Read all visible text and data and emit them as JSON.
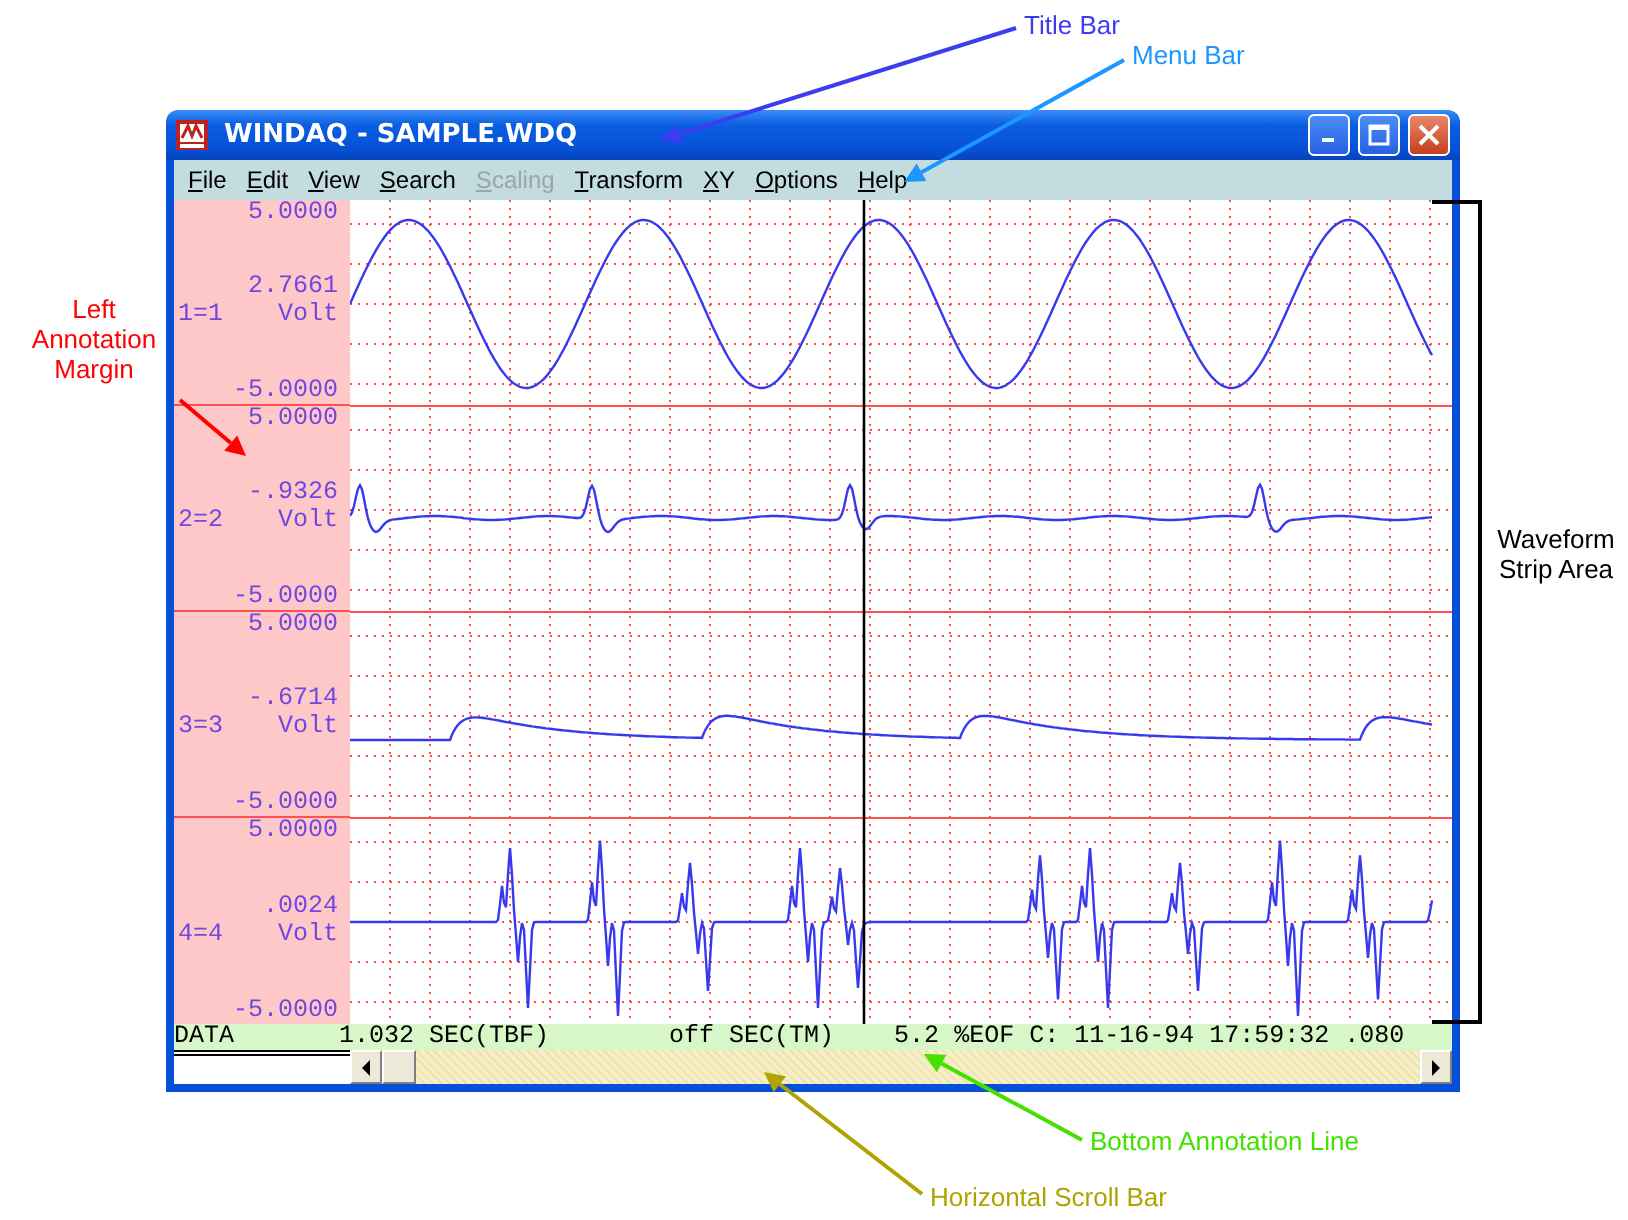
{
  "window": {
    "title": "WINDAQ - SAMPLE.WDQ"
  },
  "menu": [
    {
      "label": "File",
      "disabled": false
    },
    {
      "label": "Edit",
      "disabled": false
    },
    {
      "label": "View",
      "disabled": false
    },
    {
      "label": "Search",
      "disabled": false
    },
    {
      "label": "Scaling",
      "disabled": true
    },
    {
      "label": "Transform",
      "disabled": false
    },
    {
      "label": "XY",
      "disabled": false
    },
    {
      "label": "Options",
      "disabled": false
    },
    {
      "label": "Help",
      "disabled": false
    }
  ],
  "strips": [
    {
      "top_scale": "5.0000",
      "value": "2.7661",
      "channel": "1=1",
      "unit": "Volt",
      "bottom_scale": "-5.0000"
    },
    {
      "top_scale": "5.0000",
      "value": "-.9326",
      "channel": "2=2",
      "unit": "Volt",
      "bottom_scale": "-5.0000"
    },
    {
      "top_scale": "5.0000",
      "value": "-.6714",
      "channel": "3=3",
      "unit": "Volt",
      "bottom_scale": "-5.0000"
    },
    {
      "top_scale": "5.0000",
      "value": ".0024",
      "channel": "4=4",
      "unit": "Volt",
      "bottom_scale": "-5.0000"
    }
  ],
  "status_line": "DATA       1.032 SEC(TBF)        off SEC(TM)    5.2 %EOF C: 11-16-94 17:59:32 .080",
  "callouts": [
    {
      "text": "Title Bar",
      "color": "#3c3cf0",
      "kind": "arrow"
    },
    {
      "text": "Menu Bar",
      "color": "#1e96ff",
      "kind": "arrow"
    },
    {
      "text": "Left Annotation Margin",
      "color": "#ff0000",
      "kind": "arrow"
    },
    {
      "text": "Waveform Strip Area",
      "color": "#000000",
      "kind": "bracket"
    },
    {
      "text": "Bottom Annotation Line",
      "color": "#44e000",
      "kind": "arrow"
    },
    {
      "text": "Horizontal Scroll Bar",
      "color": "#b0a200",
      "kind": "arrow"
    }
  ]
}
